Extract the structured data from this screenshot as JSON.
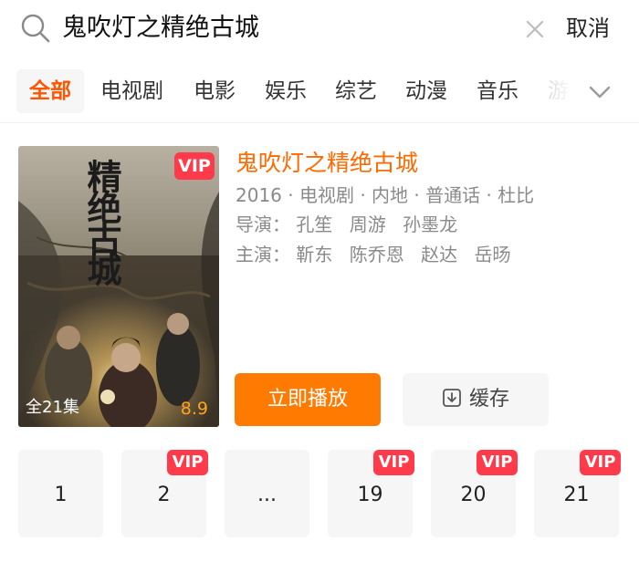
{
  "search": {
    "query": "鬼吹灯之精绝古城",
    "cancel_label": "取消"
  },
  "tabs": [
    {
      "label": "全部",
      "active": true
    },
    {
      "label": "电视剧"
    },
    {
      "label": "电影"
    },
    {
      "label": "娱乐"
    },
    {
      "label": "综艺"
    },
    {
      "label": "动漫"
    },
    {
      "label": "音乐"
    },
    {
      "label": "游"
    }
  ],
  "result": {
    "poster_title": "精绝古城",
    "vip_badge": "VIP",
    "episode_count": "全21集",
    "score": "8.9",
    "title": "鬼吹灯之精绝古城",
    "meta_line": "2016 · 电视剧 · 内地 · 普通话 · 杜比",
    "directors_label": "导演：",
    "directors": [
      "孔笙",
      "周游",
      "孙墨龙"
    ],
    "cast_label": "主演：",
    "cast": [
      "靳东",
      "陈乔恩",
      "赵达",
      "岳旸"
    ],
    "play_label": "立即播放",
    "cache_label": "缓存"
  },
  "episodes": [
    {
      "label": "1",
      "vip": false
    },
    {
      "label": "2",
      "vip": true
    },
    {
      "label": "...",
      "vip": false
    },
    {
      "label": "19",
      "vip": true
    },
    {
      "label": "20",
      "vip": true
    },
    {
      "label": "21",
      "vip": true
    }
  ],
  "icons": {
    "search": "search-icon",
    "clear": "close-icon",
    "expand": "chevron-down-icon",
    "download": "download-icon"
  },
  "colors": {
    "accent": "#ff6a00",
    "vip": "#ff3a4a",
    "play_button": "#ff7a00",
    "score": "#ffa41b"
  }
}
